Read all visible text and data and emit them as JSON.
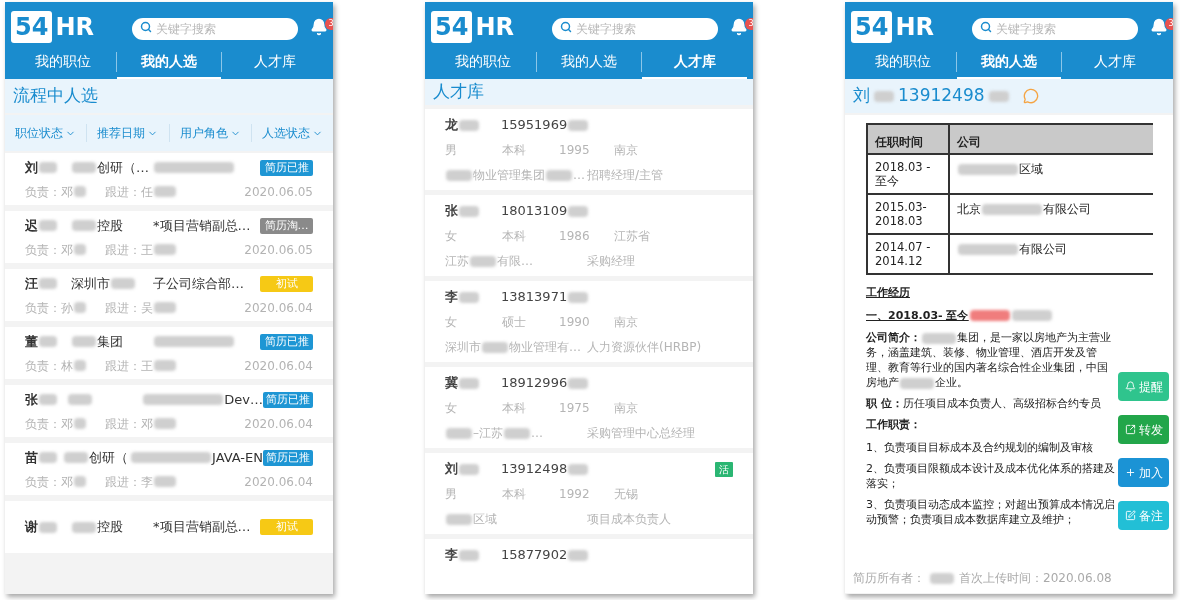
{
  "phones": [
    {
      "kind": "pipeline",
      "header": {
        "logo_number": "54",
        "logo_text": "HR",
        "search": {
          "placeholder": "关键字搜索"
        },
        "notification_count": "3"
      },
      "tabs": [
        {
          "label": "我的职位",
          "selected": false
        },
        {
          "label": "我的人选",
          "selected": true
        },
        {
          "label": "人才库",
          "selected": false
        }
      ],
      "title": [
        {
          "kind": "text",
          "text": "流程中人选"
        }
      ],
      "filters": [
        "职位状态",
        "推荐日期",
        "用户角色",
        "人选状态"
      ],
      "rows": [
        {
          "name": [
            {
              "kind": "text",
              "text": "刘"
            },
            {
              "kind": "redacted"
            }
          ],
          "company": [
            {
              "kind": "redacted"
            },
            {
              "kind": "text",
              "text": "创研（…"
            }
          ],
          "position": [
            {
              "kind": "redacted"
            }
          ],
          "status": {
            "text": "简历已推",
            "color": "#1e96d4"
          },
          "owner": [
            {
              "kind": "text",
              "text": "负责：邓"
            },
            {
              "kind": "redacted"
            }
          ],
          "follower": [
            {
              "kind": "text",
              "text": "跟进：任"
            },
            {
              "kind": "redacted"
            }
          ],
          "date": "2020.06.05"
        },
        {
          "name": [
            {
              "kind": "text",
              "text": "迟"
            },
            {
              "kind": "redacted"
            }
          ],
          "company": [
            {
              "kind": "redacted"
            },
            {
              "kind": "text",
              "text": "控股"
            }
          ],
          "position": [
            {
              "kind": "text",
              "text": "*项目营销副总…"
            }
          ],
          "status": {
            "text": "简历淘…",
            "color": "#8a8a8a"
          },
          "owner": [
            {
              "kind": "text",
              "text": "负责：邓"
            },
            {
              "kind": "redacted"
            }
          ],
          "follower": [
            {
              "kind": "text",
              "text": "跟进：王"
            },
            {
              "kind": "redacted"
            }
          ],
          "date": "2020.06.05"
        },
        {
          "name": [
            {
              "kind": "text",
              "text": "汪"
            },
            {
              "kind": "redacted"
            }
          ],
          "company": [
            {
              "kind": "text",
              "text": "深圳市"
            },
            {
              "kind": "redacted"
            }
          ],
          "position": [
            {
              "kind": "text",
              "text": "子公司综合部…"
            }
          ],
          "status": {
            "text": "初试",
            "color": "#f6c915"
          },
          "owner": [
            {
              "kind": "text",
              "text": "负责：孙"
            },
            {
              "kind": "redacted"
            }
          ],
          "follower": [
            {
              "kind": "text",
              "text": "跟进：吴"
            },
            {
              "kind": "redacted"
            }
          ],
          "date": "2020.06.04"
        },
        {
          "name": [
            {
              "kind": "text",
              "text": "董"
            },
            {
              "kind": "redacted"
            }
          ],
          "company": [
            {
              "kind": "redacted"
            },
            {
              "kind": "text",
              "text": "集团"
            }
          ],
          "position": [
            {
              "kind": "redacted"
            }
          ],
          "status": {
            "text": "简历已推",
            "color": "#1e96d4"
          },
          "owner": [
            {
              "kind": "text",
              "text": "负责：林"
            },
            {
              "kind": "redacted"
            }
          ],
          "follower": [
            {
              "kind": "text",
              "text": "跟进：王"
            },
            {
              "kind": "redacted"
            }
          ],
          "date": "2020.06.04"
        },
        {
          "name": [
            {
              "kind": "text",
              "text": "张"
            },
            {
              "kind": "redacted"
            }
          ],
          "company": [
            {
              "kind": "redacted"
            }
          ],
          "position": [
            {
              "kind": "redacted"
            },
            {
              "kind": "text",
              "text": "Dev…"
            }
          ],
          "status": {
            "text": "简历已推",
            "color": "#1e96d4"
          },
          "owner": [
            {
              "kind": "text",
              "text": "负责：邓"
            },
            {
              "kind": "redacted"
            }
          ],
          "follower": [
            {
              "kind": "text",
              "text": "跟进：邓"
            },
            {
              "kind": "redacted"
            }
          ],
          "date": "2020.06.04"
        },
        {
          "name": [
            {
              "kind": "text",
              "text": "苗"
            },
            {
              "kind": "redacted"
            }
          ],
          "company": [
            {
              "kind": "redacted"
            },
            {
              "kind": "text",
              "text": "创研（"
            }
          ],
          "position": [
            {
              "kind": "redacted"
            },
            {
              "kind": "text",
              "text": "JAVA-EN"
            }
          ],
          "status": {
            "text": "简历已推",
            "color": "#1e96d4"
          },
          "owner": [
            {
              "kind": "text",
              "text": "负责：邓"
            },
            {
              "kind": "redacted"
            }
          ],
          "follower": [
            {
              "kind": "text",
              "text": "跟进：李"
            },
            {
              "kind": "redacted"
            }
          ],
          "date": "2020.06.04"
        },
        {
          "name": [
            {
              "kind": "text",
              "text": "谢"
            },
            {
              "kind": "redacted"
            }
          ],
          "company": [
            {
              "kind": "redacted"
            },
            {
              "kind": "text",
              "text": "控股"
            }
          ],
          "position": [
            {
              "kind": "text",
              "text": "*项目营销副总…"
            }
          ],
          "status": {
            "text": "初试",
            "color": "#f6c915"
          }
        }
      ]
    },
    {
      "kind": "talent",
      "header": {
        "logo_number": "54",
        "logo_text": "HR",
        "search": {
          "placeholder": "关键字搜索"
        },
        "notification_count": "3"
      },
      "tabs": [
        {
          "label": "我的职位",
          "selected": false
        },
        {
          "label": "我的人选",
          "selected": false
        },
        {
          "label": "人才库",
          "selected": true
        }
      ],
      "title": [
        {
          "kind": "text",
          "text": "人才库"
        }
      ],
      "rows": [
        {
          "name": [
            {
              "kind": "text",
              "text": "龙"
            },
            {
              "kind": "redacted"
            }
          ],
          "phone": [
            {
              "kind": "text",
              "text": "15951969"
            },
            {
              "kind": "redacted"
            }
          ],
          "details": [
            "男",
            "本科",
            "1995",
            "南京"
          ],
          "company": [
            {
              "kind": "redacted"
            },
            {
              "kind": "text",
              "text": "物业管理集团"
            },
            {
              "kind": "redacted"
            },
            {
              "kind": "text",
              "text": "…"
            }
          ],
          "position": "招聘经理/主管"
        },
        {
          "name": [
            {
              "kind": "text",
              "text": "张"
            },
            {
              "kind": "redacted"
            }
          ],
          "phone": [
            {
              "kind": "text",
              "text": "18013109"
            },
            {
              "kind": "redacted"
            }
          ],
          "details": [
            "女",
            "本科",
            "1986",
            "江苏省"
          ],
          "company": [
            {
              "kind": "text",
              "text": "江苏"
            },
            {
              "kind": "redacted"
            },
            {
              "kind": "text",
              "text": "有限…"
            }
          ],
          "position": "采购经理"
        },
        {
          "name": [
            {
              "kind": "text",
              "text": "李"
            },
            {
              "kind": "redacted"
            }
          ],
          "phone": [
            {
              "kind": "text",
              "text": "13813971"
            },
            {
              "kind": "redacted"
            }
          ],
          "details": [
            "女",
            "硕士",
            "1990",
            "南京"
          ],
          "company": [
            {
              "kind": "text",
              "text": "深圳市"
            },
            {
              "kind": "redacted"
            },
            {
              "kind": "text",
              "text": "物业管理有…"
            }
          ],
          "position": "人力资源伙伴(HRBP)"
        },
        {
          "name": [
            {
              "kind": "text",
              "text": "冀"
            },
            {
              "kind": "redacted"
            }
          ],
          "phone": [
            {
              "kind": "text",
              "text": "18912996"
            },
            {
              "kind": "redacted"
            }
          ],
          "details": [
            "女",
            "本科",
            "1975",
            "南京"
          ],
          "company": [
            {
              "kind": "redacted"
            },
            {
              "kind": "text",
              "text": "–江苏"
            },
            {
              "kind": "redacted"
            },
            {
              "kind": "text",
              "text": "…"
            }
          ],
          "position": "采购管理中心总经理"
        },
        {
          "name": [
            {
              "kind": "text",
              "text": "刘"
            },
            {
              "kind": "redacted"
            }
          ],
          "phone": [
            {
              "kind": "text",
              "text": "13912498"
            },
            {
              "kind": "redacted"
            }
          ],
          "details": [
            "男",
            "本科",
            "1992",
            "无锡"
          ],
          "company": [
            {
              "kind": "redacted"
            },
            {
              "kind": "text",
              "text": "区域"
            }
          ],
          "position": "项目成本负责人",
          "tag": {
            "text": "活",
            "color": "#2bb673"
          }
        },
        {
          "name": [
            {
              "kind": "text",
              "text": "李"
            },
            {
              "kind": "redacted"
            }
          ],
          "phone": [
            {
              "kind": "text",
              "text": "15877902"
            },
            {
              "kind": "redacted"
            }
          ]
        }
      ]
    },
    {
      "kind": "resume",
      "header": {
        "logo_number": "54",
        "logo_text": "HR",
        "search": {
          "placeholder": "关键字搜索"
        },
        "notification_count": "3"
      },
      "tabs": [
        {
          "label": "我的职位",
          "selected": false
        },
        {
          "label": "我的人选",
          "selected": true
        },
        {
          "label": "人才库",
          "selected": false
        }
      ],
      "title": [
        {
          "kind": "text",
          "text": "刘"
        },
        {
          "kind": "redacted"
        },
        {
          "kind": "text",
          "text": "13912498"
        },
        {
          "kind": "redacted"
        }
      ],
      "table": {
        "columns": [
          "任职时间",
          "公司"
        ],
        "rows": [
          {
            "period": "2018.03 - 至今",
            "company": [
              {
                "kind": "redacted"
              },
              {
                "kind": "text",
                "text": "区域"
              }
            ]
          },
          {
            "period": "2015.03-2018.03",
            "company": [
              {
                "kind": "text",
                "text": "北京"
              },
              {
                "kind": "redacted"
              },
              {
                "kind": "text",
                "text": "有限公司"
              }
            ]
          },
          {
            "period": "2014.07 - 2014.12",
            "company": [
              {
                "kind": "redacted"
              },
              {
                "kind": "text",
                "text": "有限公司"
              }
            ]
          }
        ]
      },
      "blocks": [
        {
          "kind": "heading",
          "parts": [
            {
              "kind": "text",
              "text": "工作经历"
            }
          ]
        },
        {
          "kind": "heading",
          "parts": [
            {
              "kind": "text",
              "text": "一、2018.03- 至今"
            },
            {
              "kind": "redacted",
              "color": "#f07d7d"
            },
            {
              "kind": "redacted"
            }
          ]
        },
        {
          "kind": "paragraph",
          "parts": [
            {
              "kind": "text",
              "text": "**公司简介：**"
            },
            {
              "kind": "redacted"
            },
            {
              "kind": "text",
              "text": "集团，是一家以房地产为主营业务，涵盖建筑、装修、物业管理、酒店开发及管理、教育等行业的国内著名综合性企业集团，中国房地产"
            },
            {
              "kind": "redacted"
            },
            {
              "kind": "text",
              "text": "企业。"
            }
          ]
        },
        {
          "kind": "paragraph",
          "parts": [
            {
              "kind": "text",
              "text": "**职 位：**历任项目成本负责人、高级招标合约专员"
            }
          ]
        },
        {
          "kind": "label",
          "parts": [
            {
              "kind": "text",
              "text": "工作职责："
            }
          ]
        },
        {
          "kind": "paragraph",
          "parts": [
            {
              "kind": "text",
              "text": "1、负责项目目标成本及合约规划的编制及审核"
            }
          ]
        },
        {
          "kind": "paragraph",
          "parts": [
            {
              "kind": "text",
              "text": "2、负责项目限额成本设计及成本优化体系的搭建及落实；"
            }
          ]
        },
        {
          "kind": "paragraph",
          "parts": [
            {
              "kind": "text",
              "text": "3、负责项目动态成本监控；对超出预算成本情况启动预警；负责项目成本数据库建立及维护；"
            }
          ]
        }
      ],
      "footer": [
        {
          "kind": "text",
          "text": "简历所有者："
        },
        {
          "kind": "redacted"
        },
        {
          "kind": "text",
          "text": "首次上传时间：2020.06.08"
        }
      ],
      "actions": [
        {
          "kind": "remind",
          "label": "提醒",
          "color": "#2fc48d"
        },
        {
          "kind": "forward",
          "label": "转发",
          "color": "#22a64a"
        },
        {
          "kind": "add",
          "label": "加入",
          "color": "#1b93d5"
        },
        {
          "kind": "note",
          "label": "备注",
          "color": "#22bfd6"
        }
      ]
    }
  ]
}
